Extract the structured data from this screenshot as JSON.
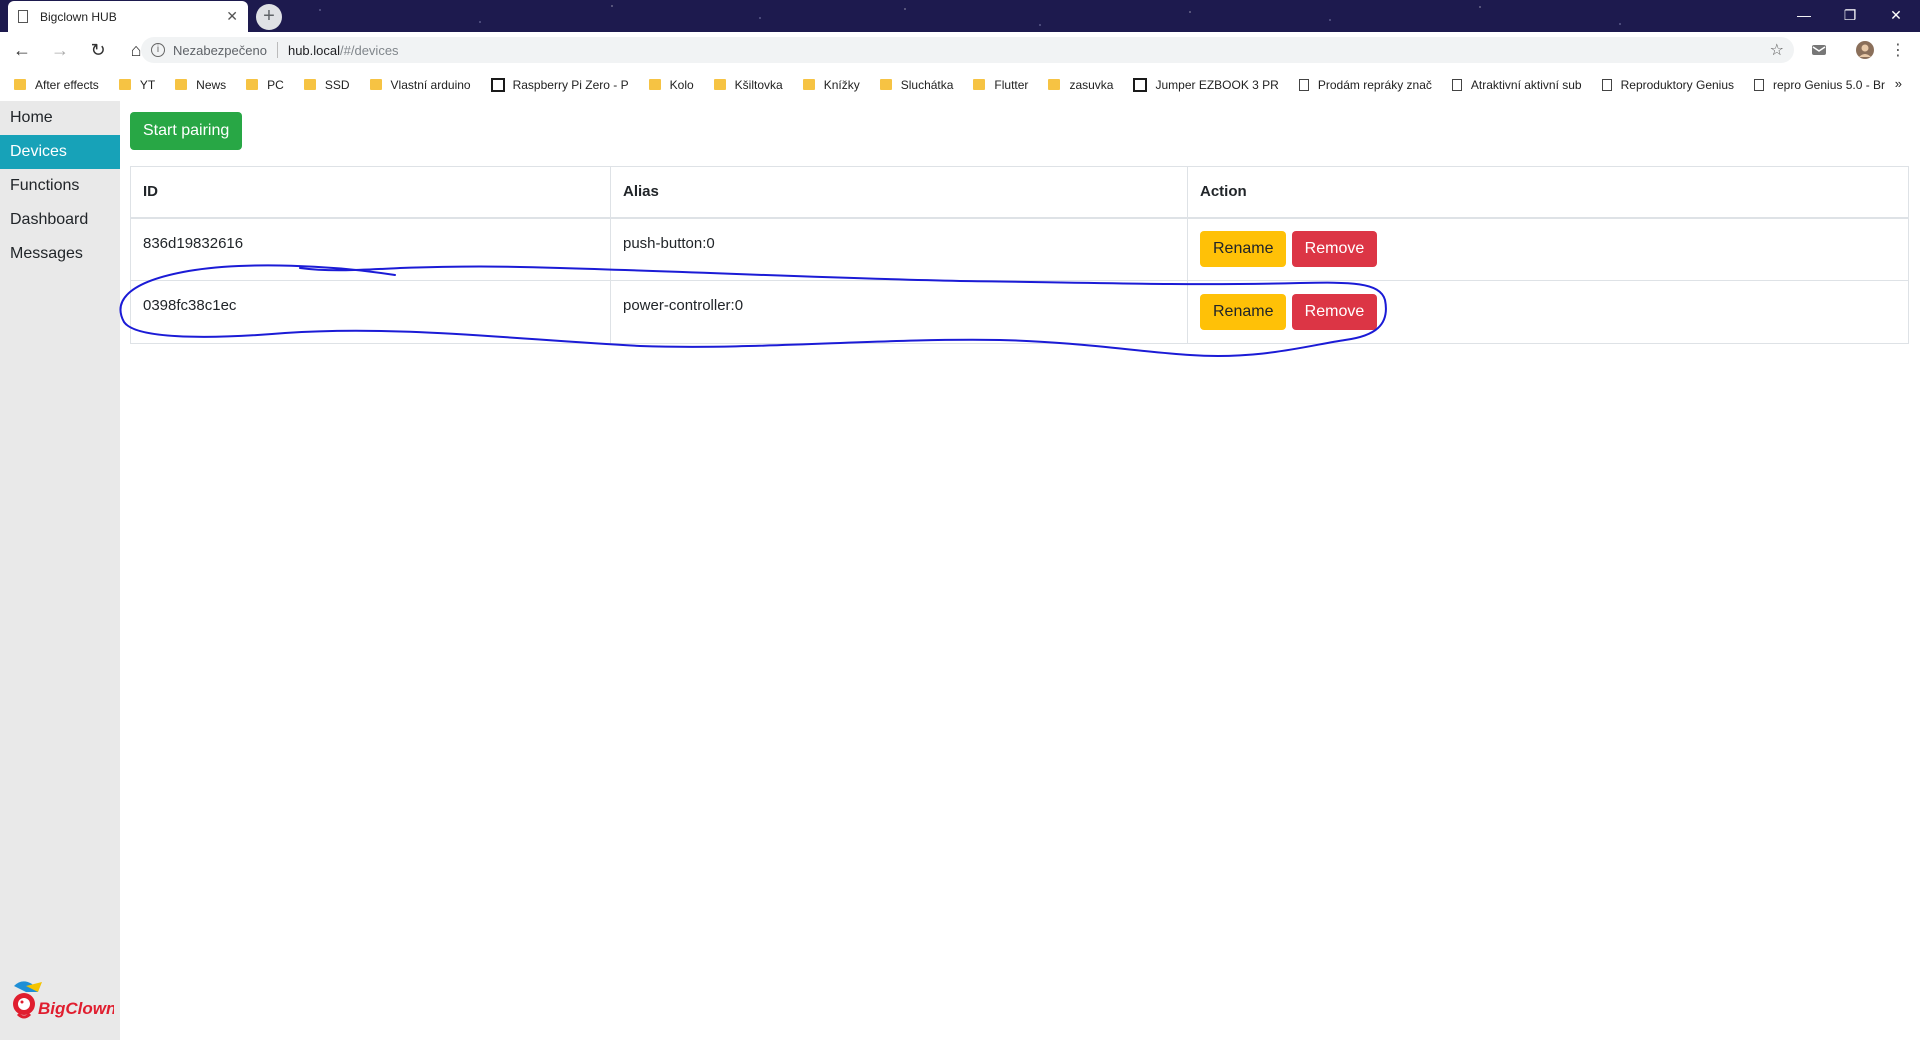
{
  "browser": {
    "tab_title": "Bigclown HUB",
    "address": {
      "security": "Nezabezpečeno",
      "host": "hub.local",
      "path": "/#/devices"
    },
    "bookmarks": [
      {
        "label": "After effects",
        "icon": "folder-icon"
      },
      {
        "label": "YT",
        "icon": "folder-icon"
      },
      {
        "label": "News",
        "icon": "folder-icon"
      },
      {
        "label": "PC",
        "icon": "folder-icon"
      },
      {
        "label": "SSD",
        "icon": "folder-icon"
      },
      {
        "label": "Vlastní arduino",
        "icon": "folder-icon"
      },
      {
        "label": "Raspberry Pi Zero - P",
        "icon": "site-icon"
      },
      {
        "label": "Kolo",
        "icon": "folder-icon"
      },
      {
        "label": "Kšiltovka",
        "icon": "folder-icon"
      },
      {
        "label": "Knížky",
        "icon": "folder-icon"
      },
      {
        "label": "Sluchátka",
        "icon": "folder-icon"
      },
      {
        "label": "Flutter",
        "icon": "folder-icon"
      },
      {
        "label": "zasuvka",
        "icon": "folder-icon"
      },
      {
        "label": "Jumper EZBOOK 3 PR",
        "icon": "site-icon"
      },
      {
        "label": "Prodám repráky znač",
        "icon": "page-icon"
      },
      {
        "label": "Atraktivní aktivní sub",
        "icon": "page-icon"
      },
      {
        "label": "Reproduktory Genius",
        "icon": "page-icon"
      },
      {
        "label": "repro Genius 5.0 - Br",
        "icon": "page-icon"
      }
    ]
  },
  "sidebar": {
    "items": [
      {
        "label": "Home",
        "active": false
      },
      {
        "label": "Devices",
        "active": true
      },
      {
        "label": "Functions",
        "active": false
      },
      {
        "label": "Dashboard",
        "active": false
      },
      {
        "label": "Messages",
        "active": false
      }
    ],
    "logo_text": "BigClown"
  },
  "main": {
    "pair_button": "Start pairing",
    "table": {
      "headers": [
        "ID",
        "Alias",
        "Action"
      ],
      "rows": [
        {
          "id": "836d19832616",
          "alias": "push-button:0",
          "rename": "Rename",
          "remove": "Remove"
        },
        {
          "id": "0398fc38c1ec",
          "alias": "power-controller:0",
          "rename": "Rename",
          "remove": "Remove"
        }
      ]
    }
  },
  "colors": {
    "accent": "#17a2b8",
    "pair": "#28a745",
    "rename": "#ffc107",
    "remove": "#dc3545",
    "annotation": "#1b1bd6"
  }
}
